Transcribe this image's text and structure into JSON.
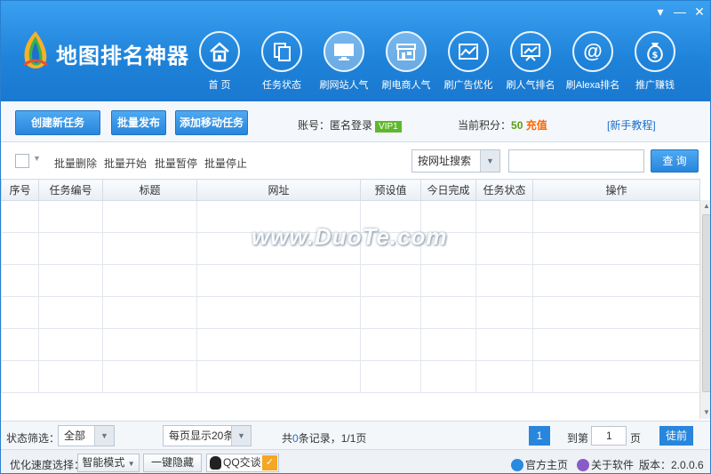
{
  "app": {
    "title": "地图排名神器",
    "window_controls": {
      "menu": "▾",
      "minimize": "—",
      "close": "✕"
    }
  },
  "nav": [
    {
      "label": "首 页",
      "icon": "home-icon"
    },
    {
      "label": "任务状态",
      "icon": "documents-icon"
    },
    {
      "label": "刷网站人气",
      "icon": "monitor-icon"
    },
    {
      "label": "刷电商人气",
      "icon": "shop-icon"
    },
    {
      "label": "刷广告优化",
      "icon": "chart-icon"
    },
    {
      "label": "刷人气排名",
      "icon": "presentation-icon"
    },
    {
      "label": "刷Alexa排名",
      "icon": "at-icon"
    },
    {
      "label": "推广赚钱",
      "icon": "money-bag-icon"
    }
  ],
  "toolbar": {
    "create_task": "创建新任务",
    "batch_publish": "批量发布",
    "add_mobile_task": "添加移动任务",
    "account_label": "账号：",
    "account_value": "匿名登录",
    "vip_badge": "VIP1",
    "points_label": "当前积分：",
    "points_value": "50",
    "recharge": "充值",
    "tutorial": "[新手教程]"
  },
  "actionbar": {
    "batch_delete": "批量删除",
    "batch_start": "批量开始",
    "batch_pause": "批量暂停",
    "batch_stop": "批量停止",
    "search_mode": "按网址搜索",
    "search_placeholder": "",
    "query_button": "查 询"
  },
  "table": {
    "columns": [
      "序号",
      "任务编号",
      "标题",
      "网址",
      "预设值",
      "今日完成",
      "任务状态",
      "操作"
    ],
    "rows": []
  },
  "watermark": "www.DuoTe.com",
  "statusbar": {
    "filter_label": "状态筛选：",
    "filter_value": "全部",
    "page_size": "每页显示20条",
    "record_prefix": "共",
    "record_count": "0",
    "record_suffix": "条记录，1/1页",
    "current_page": "1",
    "goto_label": "到第",
    "goto_value": "1",
    "page_unit": "页",
    "go_button": "徒前"
  },
  "footer": {
    "speed_label": "优化速度选择：",
    "speed_mode": "智能模式",
    "hide_button": "一键隐藏",
    "qq_button": "QQ交谈",
    "official_site": "官方主页",
    "about": "关于软件",
    "version": "版本：2.0.0.6"
  },
  "colors": {
    "header": "#1e82d9",
    "accent": "#2886dc",
    "vip": "#5fb82b",
    "recharge": "#ff6600",
    "points": "#5a9c14"
  }
}
